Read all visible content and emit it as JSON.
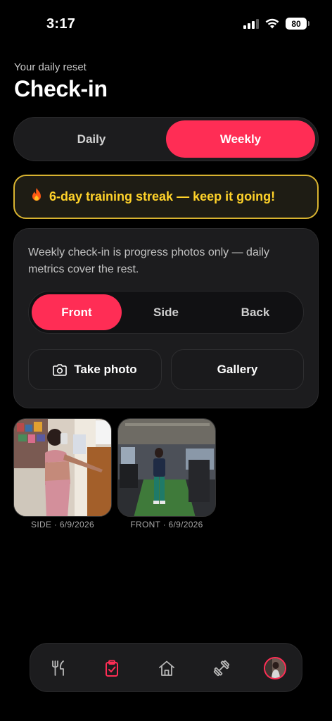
{
  "status_bar": {
    "time": "3:17",
    "battery": "80"
  },
  "header": {
    "subtitle": "Your daily reset",
    "title": "Check-in"
  },
  "mode_tabs": [
    {
      "label": "Daily",
      "active": false
    },
    {
      "label": "Weekly",
      "active": true
    }
  ],
  "streak": {
    "icon": "fire-icon",
    "text": "6-day training streak — keep it going!"
  },
  "weekly_card": {
    "note": "Weekly check-in is progress photos only — daily metrics cover the rest.",
    "poses": [
      {
        "label": "Front",
        "active": true
      },
      {
        "label": "Side",
        "active": false
      },
      {
        "label": "Back",
        "active": false
      }
    ],
    "take_photo_label": "Take photo",
    "gallery_label": "Gallery"
  },
  "photos": [
    {
      "caption": "SIDE · 6/9/2026"
    },
    {
      "caption": "FRONT · 6/9/2026"
    }
  ],
  "nav": {
    "items": [
      "fork-knife-icon",
      "clipboard-check-icon",
      "home-icon",
      "dumbbell-icon",
      "profile-avatar"
    ],
    "active": "clipboard-check-icon"
  },
  "colors": {
    "accent": "#ff2d55",
    "streak_border": "#d8b330",
    "streak_text": "#ffd22a"
  }
}
